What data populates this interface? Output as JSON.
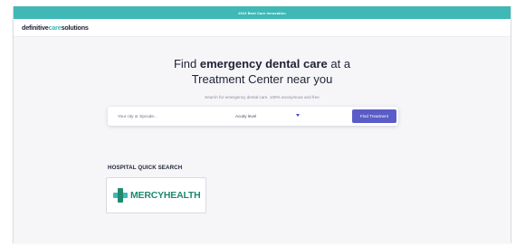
{
  "banner": {
    "text": "2024 Best Care Innovation"
  },
  "brand": {
    "part1": "definitive",
    "part2": "care",
    "part3": "solutions"
  },
  "hero": {
    "line1_prefix": "Find ",
    "line1_bold": "emergency dental care",
    "line1_suffix": " at a",
    "line2": "Treatment Center near you",
    "subtitle": "Search for emergency dental care. 100% anonymous and free"
  },
  "search": {
    "city_placeholder": "Your city or zipcode...",
    "acuity_label": "Acuity level",
    "find_button": "Find Treatment"
  },
  "quick_search": {
    "title": "HOSPITAL QUICK SEARCH",
    "hospital_name": "MERCYHEALTH"
  },
  "colors": {
    "accent": "#3fb8b6",
    "button": "#5a5cc8",
    "mercy": "#1f8a6f"
  }
}
